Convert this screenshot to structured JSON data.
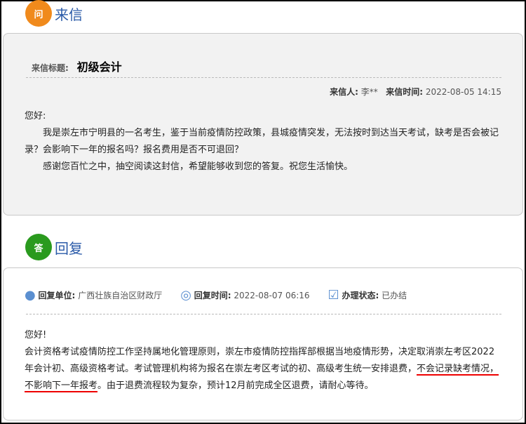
{
  "letter": {
    "section_title": "来信",
    "icon_text": "问",
    "subject_label": "来信标题:",
    "subject": "初级会计",
    "sender_label": "来信人:",
    "sender": "李**",
    "time_label": "来信时间:",
    "time": "2022-08-05 14:15",
    "greeting": "您好:",
    "para1": "我是崇左市宁明县的一名考生，鉴于当前疫情防控政策，县城疫情突发，无法按时到达当天考试，缺考是否会被记录？会影响下一年的报名吗？报名费用是否不可退回？",
    "para2": "感谢您百忙之中，抽空阅读这封信，希望能够收到您的答复。祝您生活愉快。"
  },
  "reply": {
    "section_title": "回复",
    "icon_text": "答",
    "unit_label": "回复单位:",
    "unit": "广西壮族自治区财政厅",
    "time_label": "回复时间:",
    "time": "2022-08-07 06:16",
    "status_label": "办理状态:",
    "status": "已办结",
    "greeting": "您好!",
    "text1": "会计资格考试疫情防控工作坚持属地化管理原则，崇左市疫情防控指挥部根据当地疫情形势，决定取消崇左考区2022年会计初、高级资格考试。考试管理机构将为报名在崇左考区考试的初、高级考生统一安排退费，",
    "underlined": "不会记录缺考情况，不影响下一年报考",
    "text2": "。由于退费流程较为复杂，预计12月前完成全区退费，请耐心等待。"
  }
}
